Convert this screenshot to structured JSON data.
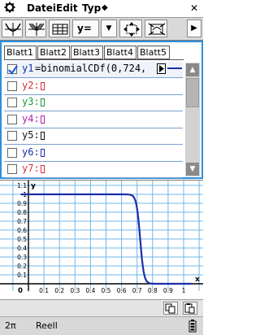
{
  "menu": {
    "gear_icon": "gear-icon",
    "items": [
      "Datei",
      "Edit",
      "Typ",
      "◆"
    ],
    "close": "✕"
  },
  "toolbar": {
    "type_label": "y=",
    "dropdown": "▼",
    "more": "▶"
  },
  "editor": {
    "tabs": [
      "Blatt1",
      "Blatt2",
      "Blatt3",
      "Blatt4",
      "Blatt5"
    ],
    "rows": [
      {
        "label": "y1",
        "expr": "=binomialCDf(0,724,",
        "checked": true,
        "color": "#1b2fa8"
      },
      {
        "label": "y2:",
        "expr": "",
        "checked": false,
        "color": "#d4303b"
      },
      {
        "label": "y3:",
        "expr": "",
        "checked": false,
        "color": "#1d9a35"
      },
      {
        "label": "y4:",
        "expr": "",
        "checked": false,
        "color": "#b021a8"
      },
      {
        "label": "y5:",
        "expr": "",
        "checked": false,
        "color": "#111111"
      },
      {
        "label": "y6:",
        "expr": "",
        "checked": false,
        "color": "#1b2fa8"
      },
      {
        "label": "y7:",
        "expr": "",
        "checked": false,
        "color": "#d4303b"
      }
    ],
    "scroll_up": "▲",
    "scroll_down": "▼"
  },
  "graph": {
    "y_axis_label": "y",
    "x_axis_label": "x",
    "y_ticks": [
      "1.1",
      "1",
      "0.9",
      "0.8",
      "0.7",
      "0.6",
      "0.5",
      "0.4",
      "0.3",
      "0.2",
      "0.1",
      "0"
    ],
    "x_ticks": [
      "0",
      "0.1",
      "0.2",
      "0.3",
      "0.4",
      "0.5",
      "0.6",
      "0.7",
      "0.8",
      "0.9",
      "1"
    ],
    "curve_color": "#1b2fa8"
  },
  "status": {
    "mode": "2π",
    "number_format": "Reell",
    "battery_icon": "battery-icon"
  }
}
